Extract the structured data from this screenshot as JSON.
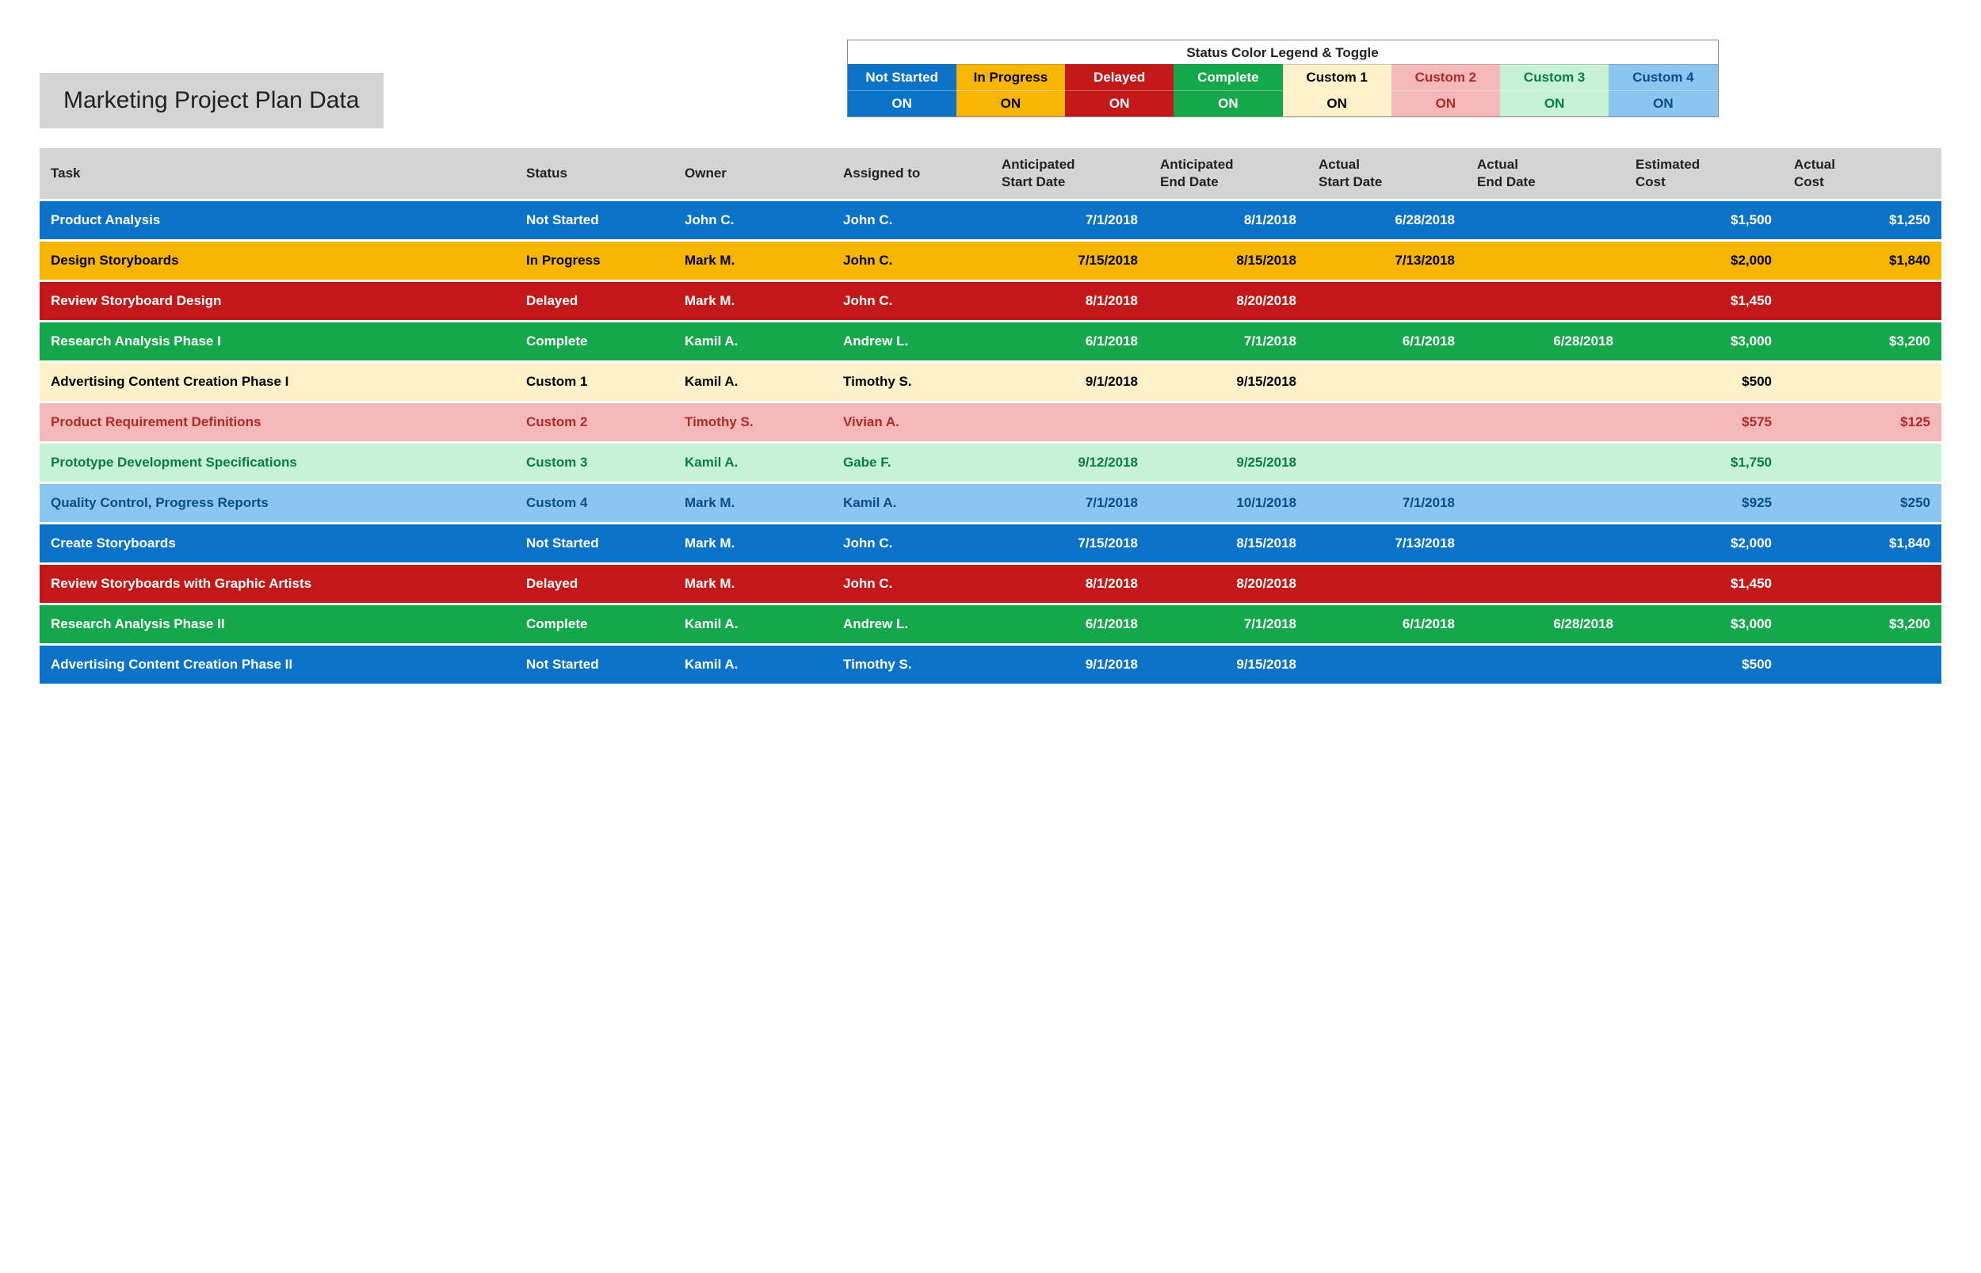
{
  "title": "Marketing Project Plan Data",
  "legend": {
    "heading": "Status Color Legend & Toggle",
    "items": [
      {
        "label": "Not Started",
        "toggle": "ON",
        "bg": "#0a72c7",
        "fg": "#ffffff"
      },
      {
        "label": "In Progress",
        "toggle": "ON",
        "bg": "#f7b500",
        "fg": "#000000"
      },
      {
        "label": "Delayed",
        "toggle": "ON",
        "bg": "#c31818",
        "fg": "#ffffff"
      },
      {
        "label": "Complete",
        "toggle": "ON",
        "bg": "#14a84b",
        "fg": "#ffffff"
      },
      {
        "label": "Custom 1",
        "toggle": "ON",
        "bg": "#fff1c8",
        "fg": "#000000"
      },
      {
        "label": "Custom 2",
        "toggle": "ON",
        "bg": "#f6b9b9",
        "fg": "#b02a2a"
      },
      {
        "label": "Custom 3",
        "toggle": "ON",
        "bg": "#c6f2d6",
        "fg": "#0a7d45"
      },
      {
        "label": "Custom 4",
        "toggle": "ON",
        "bg": "#8ac6f0",
        "fg": "#0a4d8a"
      }
    ]
  },
  "status_styles": {
    "Not Started": {
      "bg": "#0a72c7",
      "fg": "#ffffff"
    },
    "In Progress": {
      "bg": "#f7b500",
      "fg": "#000000"
    },
    "Delayed": {
      "bg": "#c31818",
      "fg": "#ffffff"
    },
    "Complete": {
      "bg": "#14a84b",
      "fg": "#ffffff"
    },
    "Custom 1": {
      "bg": "#fff1c8",
      "fg": "#000000"
    },
    "Custom 2": {
      "bg": "#f6b9b9",
      "fg": "#b02a2a"
    },
    "Custom 3": {
      "bg": "#c6f2d6",
      "fg": "#0a7d45"
    },
    "Custom 4": {
      "bg": "#8ac6f0",
      "fg": "#0a4d8a"
    }
  },
  "columns": [
    "Task",
    "Status",
    "Owner",
    "Assigned to",
    "Anticipated Start Date",
    "Anticipated End Date",
    "Actual Start Date",
    "Actual End Date",
    "Estimated Cost",
    "Actual Cost"
  ],
  "rows": [
    {
      "task": "Product Analysis",
      "status": "Not Started",
      "owner": "John C.",
      "assigned": "John C.",
      "anticipated_start": "7/1/2018",
      "anticipated_end": "8/1/2018",
      "actual_start": "6/28/2018",
      "actual_end": "",
      "est_cost": "$1,500",
      "act_cost": "$1,250"
    },
    {
      "task": "Design Storyboards",
      "status": "In Progress",
      "owner": "Mark M.",
      "assigned": "John C.",
      "anticipated_start": "7/15/2018",
      "anticipated_end": "8/15/2018",
      "actual_start": "7/13/2018",
      "actual_end": "",
      "est_cost": "$2,000",
      "act_cost": "$1,840"
    },
    {
      "task": "Review Storyboard Design",
      "status": "Delayed",
      "owner": "Mark M.",
      "assigned": "John C.",
      "anticipated_start": "8/1/2018",
      "anticipated_end": "8/20/2018",
      "actual_start": "",
      "actual_end": "",
      "est_cost": "$1,450",
      "act_cost": ""
    },
    {
      "task": "Research Analysis Phase I",
      "status": "Complete",
      "owner": "Kamil A.",
      "assigned": "Andrew L.",
      "anticipated_start": "6/1/2018",
      "anticipated_end": "7/1/2018",
      "actual_start": "6/1/2018",
      "actual_end": "6/28/2018",
      "est_cost": "$3,000",
      "act_cost": "$3,200"
    },
    {
      "task": "Advertising Content Creation Phase I",
      "status": "Custom 1",
      "owner": "Kamil A.",
      "assigned": "Timothy S.",
      "anticipated_start": "9/1/2018",
      "anticipated_end": "9/15/2018",
      "actual_start": "",
      "actual_end": "",
      "est_cost": "$500",
      "act_cost": ""
    },
    {
      "task": "Product Requirement Definitions",
      "status": "Custom 2",
      "owner": "Timothy S.",
      "assigned": "Vivian A.",
      "anticipated_start": "",
      "anticipated_end": "",
      "actual_start": "",
      "actual_end": "",
      "est_cost": "$575",
      "act_cost": "$125"
    },
    {
      "task": "Prototype Development Specifications",
      "status": "Custom 3",
      "owner": "Kamil A.",
      "assigned": "Gabe F.",
      "anticipated_start": "9/12/2018",
      "anticipated_end": "9/25/2018",
      "actual_start": "",
      "actual_end": "",
      "est_cost": "$1,750",
      "act_cost": ""
    },
    {
      "task": "Quality Control, Progress Reports",
      "status": "Custom 4",
      "owner": "Mark M.",
      "assigned": "Kamil A.",
      "anticipated_start": "7/1/2018",
      "anticipated_end": "10/1/2018",
      "actual_start": "7/1/2018",
      "actual_end": "",
      "est_cost": "$925",
      "act_cost": "$250"
    },
    {
      "task": "Create Storyboards",
      "status": "Not Started",
      "owner": "Mark M.",
      "assigned": "John C.",
      "anticipated_start": "7/15/2018",
      "anticipated_end": "8/15/2018",
      "actual_start": "7/13/2018",
      "actual_end": "",
      "est_cost": "$2,000",
      "act_cost": "$1,840"
    },
    {
      "task": "Review Storyboards with Graphic Artists",
      "status": "Delayed",
      "owner": "Mark M.",
      "assigned": "John C.",
      "anticipated_start": "8/1/2018",
      "anticipated_end": "8/20/2018",
      "actual_start": "",
      "actual_end": "",
      "est_cost": "$1,450",
      "act_cost": ""
    },
    {
      "task": "Research Analysis Phase II",
      "status": "Complete",
      "owner": "Kamil A.",
      "assigned": "Andrew L.",
      "anticipated_start": "6/1/2018",
      "anticipated_end": "7/1/2018",
      "actual_start": "6/1/2018",
      "actual_end": "6/28/2018",
      "est_cost": "$3,000",
      "act_cost": "$3,200"
    },
    {
      "task": "Advertising Content Creation Phase II",
      "status": "Not Started",
      "owner": "Kamil A.",
      "assigned": "Timothy S.",
      "anticipated_start": "9/1/2018",
      "anticipated_end": "9/15/2018",
      "actual_start": "",
      "actual_end": "",
      "est_cost": "$500",
      "act_cost": ""
    }
  ]
}
